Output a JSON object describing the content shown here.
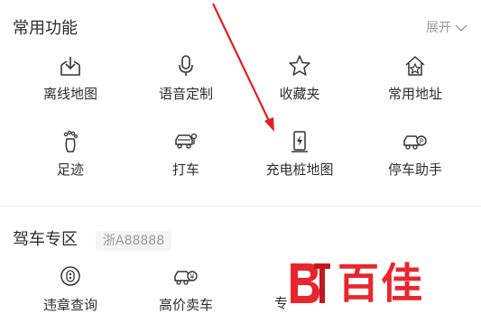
{
  "common": {
    "title": "常用功能",
    "expand_label": "展开",
    "items": [
      {
        "label": "离线地图",
        "icon": "offline-download-icon"
      },
      {
        "label": "语音定制",
        "icon": "microphone-icon"
      },
      {
        "label": "收藏夹",
        "icon": "star-icon"
      },
      {
        "label": "常用地址",
        "icon": "home-star-icon"
      },
      {
        "label": "足迹",
        "icon": "footprint-icon"
      },
      {
        "label": "打车",
        "icon": "taxi-icon"
      },
      {
        "label": "充电桩地图",
        "icon": "charging-pile-icon"
      },
      {
        "label": "停车助手",
        "icon": "parking-car-icon"
      }
    ]
  },
  "driving": {
    "title": "驾车专区",
    "plate": "浙A88888",
    "items": [
      {
        "label": "违章查询",
        "icon": "violation-query-icon"
      },
      {
        "label": "高价卖车",
        "icon": "sell-car-icon"
      },
      {
        "label": "专",
        "icon": ""
      }
    ]
  },
  "watermark": {
    "text": "百佳"
  },
  "colors": {
    "annotation_arrow": "#e02020",
    "logo": "#e8262c"
  }
}
